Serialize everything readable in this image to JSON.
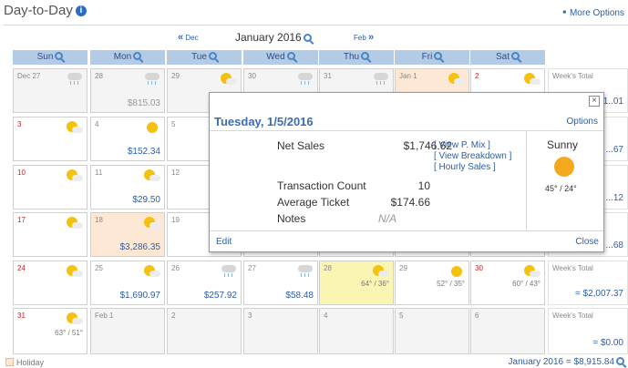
{
  "header": {
    "title": "Day-to-Day",
    "more_options": "More Options"
  },
  "nav": {
    "prev": "Dec",
    "month": "January 2016",
    "next": "Feb"
  },
  "weekdays": [
    "Sun",
    "Mon",
    "Tue",
    "Wed",
    "Thu",
    "Fri",
    "Sat"
  ],
  "weeks": [
    {
      "days": [
        {
          "num": "Dec 27",
          "other": true,
          "weather": "rain-cloud-icon",
          "sales": ""
        },
        {
          "num": "28",
          "other": true,
          "weather": "rain-cloud-icon",
          "sales": "$815.03"
        },
        {
          "num": "29",
          "other": true,
          "weather": "partly-sunny-icon",
          "sales": "$1,..."
        },
        {
          "num": "30",
          "other": true,
          "weather": "rain-cloud-icon",
          "sales": ""
        },
        {
          "num": "31",
          "other": true,
          "weather": "rain-cloud-icon",
          "sales": ""
        },
        {
          "num": "Jan 1",
          "holiday": true,
          "weather": "partly-sunny-icon",
          "sales": ""
        },
        {
          "num": "2",
          "red": true,
          "weather": "partly-sunny-icon",
          "sales": ""
        }
      ],
      "total_label": "Week's Total",
      "total": "$1,1..01"
    },
    {
      "days": [
        {
          "num": "3",
          "red": true,
          "weather": "partly-sunny-icon",
          "sales": ""
        },
        {
          "num": "4",
          "weather": "sun-icon",
          "sales": "$152.34"
        },
        {
          "num": "5",
          "weather": "partly-sunny-icon",
          "sales": "$1,7"
        },
        {
          "num": "",
          "weather": "",
          "sales": ""
        },
        {
          "num": "",
          "weather": "",
          "sales": ""
        },
        {
          "num": "",
          "weather": "",
          "sales": ""
        },
        {
          "num": "",
          "weather": "",
          "sales": ""
        }
      ],
      "total_label": "",
      "total": "...67"
    },
    {
      "days": [
        {
          "num": "10",
          "red": true,
          "weather": "partly-sunny-icon",
          "sales": ""
        },
        {
          "num": "11",
          "weather": "partly-sunny-icon",
          "sales": "$29.50"
        },
        {
          "num": "12",
          "weather": "",
          "sales": "$"
        },
        {
          "num": "",
          "weather": "",
          "sales": ""
        },
        {
          "num": "",
          "weather": "",
          "sales": ""
        },
        {
          "num": "",
          "weather": "",
          "sales": ""
        },
        {
          "num": "",
          "weather": "",
          "sales": ""
        }
      ],
      "total_label": "",
      "total": "...12"
    },
    {
      "days": [
        {
          "num": "17",
          "red": true,
          "weather": "partly-sunny-icon",
          "sales": ""
        },
        {
          "num": "18",
          "holiday": true,
          "weather": "partly-sunny-icon",
          "sales": "$3,286.35"
        },
        {
          "num": "19",
          "weather": "",
          "sales": "$"
        },
        {
          "num": "",
          "weather": "",
          "sales": ""
        },
        {
          "num": "",
          "weather": "",
          "sales": ""
        },
        {
          "num": "",
          "weather": "",
          "sales": ""
        },
        {
          "num": "",
          "weather": "",
          "sales": ""
        }
      ],
      "total_label": "",
      "total": "...68"
    },
    {
      "days": [
        {
          "num": "24",
          "red": true,
          "weather": "partly-sunny-icon",
          "sales": ""
        },
        {
          "num": "25",
          "weather": "partly-sunny-icon",
          "sales": "$1,690.97"
        },
        {
          "num": "26",
          "weather": "rain-cloud-icon",
          "sales": "$257.92"
        },
        {
          "num": "27",
          "weather": "rain-cloud-icon",
          "sales": "$58.48"
        },
        {
          "num": "28",
          "today": true,
          "weather": "partly-sunny-icon",
          "temp": "64° / 36°",
          "sales": ""
        },
        {
          "num": "29",
          "weather": "sun-icon",
          "temp": "52° / 35°",
          "sales": ""
        },
        {
          "num": "30",
          "red": true,
          "weather": "partly-sunny-icon",
          "temp": "60° / 43°",
          "sales": ""
        }
      ],
      "total_label": "Week's Total",
      "total": "= $2,007.37"
    },
    {
      "days": [
        {
          "num": "31",
          "red": true,
          "weather": "partly-sunny-icon",
          "temp": "63° / 51°",
          "sales": ""
        },
        {
          "num": "Feb 1",
          "other": true,
          "weather": "",
          "sales": ""
        },
        {
          "num": "2",
          "other": true,
          "weather": "",
          "sales": ""
        },
        {
          "num": "3",
          "other": true,
          "weather": "",
          "sales": ""
        },
        {
          "num": "4",
          "other": true,
          "weather": "",
          "sales": ""
        },
        {
          "num": "5",
          "other": true,
          "weather": "",
          "sales": ""
        },
        {
          "num": "6",
          "other": true,
          "weather": "",
          "sales": ""
        }
      ],
      "total_label": "Week's Total",
      "total": "= $0.00"
    }
  ],
  "legend": {
    "holiday": "Holiday"
  },
  "grand_total": "January 2016 = $8,915.84",
  "popup": {
    "title": "Tuesday, 1/5/2016",
    "options": "Options",
    "net_sales_label": "Net Sales",
    "net_sales": "$1,746.62",
    "link_pmix": "[ View P. Mix ]",
    "link_breakdown": "[ View Breakdown ]",
    "link_hourly": "[ Hourly Sales ]",
    "transaction_label": "Transaction Count",
    "transaction": "10",
    "avg_label": "Average Ticket",
    "avg": "$174.66",
    "notes_label": "Notes",
    "notes": "N/A",
    "weather": "Sunny",
    "weather_icon": "big-sun-icon",
    "temp": "45° / 24°",
    "edit": "Edit",
    "close": "Close",
    "close_x": "×"
  },
  "colors": {
    "accent": "#2b5ea8",
    "header_bg": "#b4cbe6",
    "holiday": "#fde8d6",
    "today": "#fbf5b4",
    "weekend_red": "#d32020"
  }
}
